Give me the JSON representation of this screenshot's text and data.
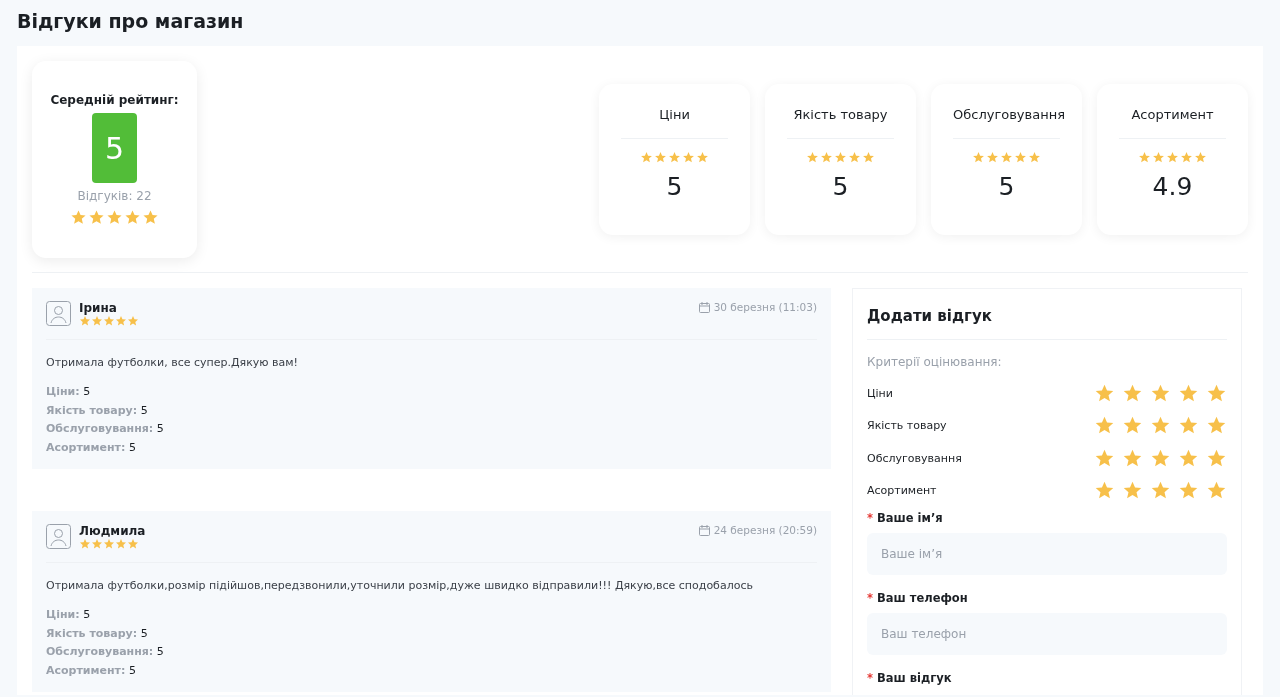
{
  "title": "Відгуки про магазин",
  "summary": {
    "label": "Середній рейтинг:",
    "score": "5",
    "count": "Відгуків: 22",
    "stars": 5
  },
  "categories": [
    {
      "name": "Ціни",
      "stars": 5,
      "value": "5"
    },
    {
      "name": "Якість товару",
      "stars": 5,
      "value": "5"
    },
    {
      "name": "Обслуговування",
      "stars": 5,
      "value": "5"
    },
    {
      "name": "Асортимент",
      "stars": 5,
      "value": "4.9"
    }
  ],
  "reviews": [
    {
      "author": "Ірина",
      "stars": 5,
      "date": "30 березня (11:03)",
      "text": "Отримала футболки, все супер.Дякую вам!",
      "ratings": [
        {
          "label": "Ціни:",
          "value": "5"
        },
        {
          "label": "Якість товару:",
          "value": "5"
        },
        {
          "label": "Обслуговування:",
          "value": "5"
        },
        {
          "label": "Асортимент:",
          "value": "5"
        }
      ]
    },
    {
      "author": "Людмила",
      "stars": 5,
      "date": "24 березня (20:59)",
      "text": "Отримала футболки,розмір підійшов,передзвонили,уточнили розмір,дуже швидко відправили!!! Дякую,все сподобалось",
      "ratings": [
        {
          "label": "Ціни:",
          "value": "5"
        },
        {
          "label": "Якість товару:",
          "value": "5"
        },
        {
          "label": "Обслуговування:",
          "value": "5"
        },
        {
          "label": "Асортимент:",
          "value": "5"
        }
      ]
    }
  ],
  "form": {
    "title": "Додати відгук",
    "criteria_label": "Критерії оцінювання:",
    "criteria": [
      {
        "name": "Ціни",
        "stars": 5
      },
      {
        "name": "Якість товару",
        "stars": 5
      },
      {
        "name": "Обслуговування",
        "stars": 5
      },
      {
        "name": "Асортимент",
        "stars": 5
      }
    ],
    "fields": [
      {
        "kind": "input",
        "mark": "*",
        "label": "Ваше ім’я",
        "placeholder": "Ваше ім’я"
      },
      {
        "kind": "input",
        "mark": "*",
        "label": "Ваш телефон",
        "placeholder": "Ваш телефон"
      },
      {
        "kind": "label",
        "mark": "*",
        "label": "Ваш відгук"
      }
    ]
  }
}
